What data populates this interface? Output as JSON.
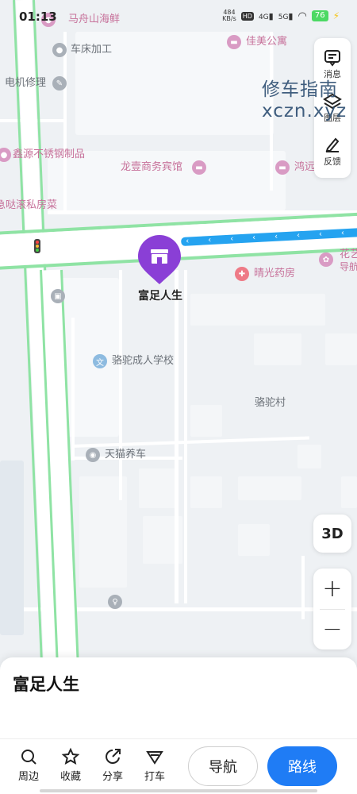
{
  "status_bar": {
    "time": "01:13",
    "net_speed_value": "484",
    "net_speed_unit": "KB/s",
    "hd_badge": "HD",
    "net_4g": "4G",
    "net_5g": "5G",
    "battery": "76"
  },
  "map": {
    "pois": {
      "seafood": "马舟山海鲜",
      "lathe": "车床加工",
      "apartment": "佳美公寓",
      "motor_repair": "电机修理",
      "stainless": "鑫源不锈钢制品",
      "hotel": "龙壹商务宾馆",
      "hongyuan": "鸿远",
      "private_kitchen": "急哒滚私房菜",
      "huayi": "花艺",
      "daohang": "导航",
      "pharmacy": "晴光药房",
      "adult_school": "骆驼成人学校",
      "village": "骆驼村",
      "car_care": "天猫养车"
    },
    "selected_place": "富足人生"
  },
  "side_panel": {
    "message": "消息",
    "layers": "图层",
    "feedback": "反馈"
  },
  "watermark": {
    "line1": "修车指南",
    "line2": "xczn.xyz"
  },
  "controls": {
    "three_d": "3D",
    "zoom_in": "+",
    "zoom_out": "−"
  },
  "sheet": {
    "place_name": "富足人生",
    "toolbar": {
      "nearby": "周边",
      "favorite": "收藏",
      "share": "分享",
      "taxi": "打车"
    },
    "navigate": "导航",
    "route": "路线"
  },
  "colors": {
    "accent_blue": "#1f7cf5",
    "pin_purple": "#8a3fd6",
    "traffic_blue": "#25a3f0",
    "road_green": "#8fe3a4"
  }
}
